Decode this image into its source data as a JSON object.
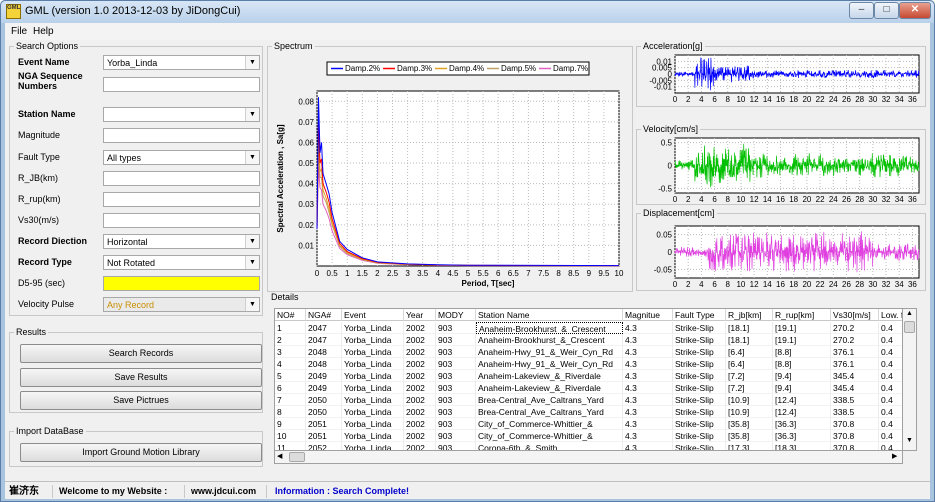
{
  "window": {
    "title": "GML (version 1.0 2013-12-03 by JiDongCui)",
    "icon": "GML"
  },
  "menu": [
    "File",
    "Help"
  ],
  "search": {
    "title": "Search Options",
    "fields": [
      {
        "label": "Event Name",
        "bold": true,
        "value": "Yorba_Linda",
        "dropdown": true,
        "style": ""
      },
      {
        "label": "NGA Sequence Numbers",
        "bold": true,
        "value": "",
        "dropdown": false,
        "style": ""
      },
      {
        "label": "Station Name",
        "bold": true,
        "value": "",
        "dropdown": true,
        "style": ""
      },
      {
        "label": "Magnitude",
        "bold": false,
        "value": "",
        "dropdown": false,
        "style": ""
      },
      {
        "label": "Fault Type",
        "bold": false,
        "value": "All types",
        "dropdown": true,
        "style": ""
      },
      {
        "label": "R_JB(km)",
        "bold": false,
        "value": "",
        "dropdown": false,
        "style": ""
      },
      {
        "label": "R_rup(km)",
        "bold": false,
        "value": "",
        "dropdown": false,
        "style": ""
      },
      {
        "label": "Vs30(m/s)",
        "bold": false,
        "value": "",
        "dropdown": false,
        "style": ""
      },
      {
        "label": "Record Diection",
        "bold": true,
        "value": "Horizontal",
        "dropdown": true,
        "style": ""
      },
      {
        "label": "Record Type",
        "bold": true,
        "value": "Not Rotated",
        "dropdown": true,
        "style": ""
      },
      {
        "label": "D5-95 (sec)",
        "bold": false,
        "value": "",
        "dropdown": false,
        "style": "yel"
      },
      {
        "label": "Velocity Pulse",
        "bold": false,
        "value": "Any Record",
        "dropdown": true,
        "style": "dis"
      }
    ]
  },
  "results": {
    "title": "Results",
    "buttons": [
      "Search Records",
      "Save Results",
      "Save Pictrues"
    ]
  },
  "import": {
    "title": "Import DataBase",
    "button": "Import Ground Motion Library"
  },
  "spectrum": {
    "title": "Spectrum",
    "legend": [
      "Damp.2%",
      "Damp.3%",
      "Damp.4%",
      "Damp.5%",
      "Damp.7%"
    ],
    "legend_colors": [
      "#0000ff",
      "#ff0000",
      "#e0a020",
      "#c0a060",
      "#e060c0"
    ],
    "ylabel": "Spectral Acceleration , Sa[g]",
    "xlabel": "Period, T[sec]"
  },
  "chart_data": [
    {
      "type": "line",
      "title": "Spectrum",
      "xlabel": "Period, T[sec]",
      "ylabel": "Spectral Acceleration , Sa[g]",
      "xlim": [
        0,
        10
      ],
      "ylim": [
        0,
        0.085
      ],
      "grid": true,
      "legend": "top",
      "xticks": [
        "0",
        "0.5",
        "1",
        "1.5",
        "2",
        "2.5",
        "3",
        "3.5",
        "4",
        "4.5",
        "5",
        "5.5",
        "6",
        "6.5",
        "7",
        "7.5",
        "8",
        "8.5",
        "9",
        "9.5",
        "10"
      ],
      "yticks": [
        "0.01",
        "0.02",
        "0.03",
        "0.04",
        "0.05",
        "0.06",
        "0.07",
        "0.08"
      ],
      "x": [
        0,
        0.05,
        0.1,
        0.15,
        0.2,
        0.3,
        0.4,
        0.5,
        0.75,
        1,
        1.5,
        2,
        3,
        4,
        5,
        10
      ],
      "series": [
        {
          "name": "Damp.2%",
          "values": [
            0.018,
            0.082,
            0.055,
            0.06,
            0.045,
            0.04,
            0.035,
            0.026,
            0.012,
            0.008,
            0.004,
            0.002,
            0.001,
            0.0006,
            0.0004,
            0.0002
          ]
        },
        {
          "name": "Damp.3%",
          "values": [
            0.018,
            0.07,
            0.05,
            0.052,
            0.04,
            0.036,
            0.031,
            0.023,
            0.011,
            0.007,
            0.0036,
            0.0018,
            0.0009,
            0.0005,
            0.0003,
            0.0002
          ]
        },
        {
          "name": "Damp.4%",
          "values": [
            0.018,
            0.062,
            0.046,
            0.047,
            0.037,
            0.033,
            0.028,
            0.021,
            0.01,
            0.0065,
            0.0033,
            0.0016,
            0.0008,
            0.0005,
            0.0003,
            0.0002
          ]
        },
        {
          "name": "Damp.5%",
          "values": [
            0.018,
            0.056,
            0.043,
            0.043,
            0.034,
            0.031,
            0.026,
            0.02,
            0.0095,
            0.006,
            0.003,
            0.0015,
            0.0007,
            0.0004,
            0.0003,
            0.0002
          ]
        },
        {
          "name": "Damp.7%",
          "values": [
            0.018,
            0.048,
            0.038,
            0.037,
            0.03,
            0.027,
            0.023,
            0.017,
            0.0085,
            0.0055,
            0.0027,
            0.0013,
            0.0006,
            0.0004,
            0.0002,
            0.0001
          ]
        }
      ]
    },
    {
      "type": "line",
      "title": "Acceleration[g]",
      "xlim": [
        0,
        37
      ],
      "ylim": [
        -0.015,
        0.015
      ],
      "yticks": [
        "0.01",
        "0.005",
        "0",
        "-0.005",
        "-0.01"
      ],
      "xticks": [
        "0",
        "2",
        "4",
        "6",
        "8",
        "10",
        "12",
        "14",
        "16",
        "18",
        "20",
        "22",
        "24",
        "26",
        "28",
        "30",
        "32",
        "34",
        "36"
      ],
      "color": "#0000ff"
    },
    {
      "type": "line",
      "title": "Velocity[cm/s]",
      "xlim": [
        0,
        37
      ],
      "ylim": [
        -0.6,
        0.6
      ],
      "yticks": [
        "0.5",
        "0",
        "-0.5"
      ],
      "xticks": [
        "0",
        "2",
        "4",
        "6",
        "8",
        "10",
        "12",
        "14",
        "16",
        "18",
        "20",
        "22",
        "24",
        "26",
        "28",
        "30",
        "32",
        "34",
        "36"
      ],
      "color": "#00c000"
    },
    {
      "type": "line",
      "title": "Displacement[cm]",
      "xlim": [
        0,
        37
      ],
      "ylim": [
        -0.075,
        0.075
      ],
      "yticks": [
        "0.05",
        "0",
        "-0.05"
      ],
      "xticks": [
        "0",
        "2",
        "4",
        "6",
        "8",
        "10",
        "12",
        "14",
        "16",
        "18",
        "20",
        "22",
        "24",
        "26",
        "28",
        "30",
        "32",
        "34",
        "36"
      ],
      "color": "#e040e0"
    }
  ],
  "details": {
    "title": "Details",
    "columns": [
      "NO#",
      "NGA#",
      "Event",
      "Year",
      "MODY",
      "Station Name",
      "Magnitue",
      "Fault Type",
      "R_jb[km]",
      "R_rup[km]",
      "Vs30[m/s]",
      "Low. fre"
    ],
    "rows": [
      [
        "1",
        "2047",
        "Yorba_Linda",
        "2002",
        "903",
        "Anaheim-Brookhurst_&_Crescent",
        "4.3",
        "Strike-Slip",
        "[18.1]",
        "[19.1]",
        "270.2",
        "0.4"
      ],
      [
        "2",
        "2047",
        "Yorba_Linda",
        "2002",
        "903",
        "Anaheim-Brookhurst_&_Crescent",
        "4.3",
        "Strike-Slip",
        "[18.1]",
        "[19.1]",
        "270.2",
        "0.4"
      ],
      [
        "3",
        "2048",
        "Yorba_Linda",
        "2002",
        "903",
        "Anaheim-Hwy_91_&_Weir_Cyn_Rd",
        "4.3",
        "Strike-Slip",
        "[6.4]",
        "[8.8]",
        "376.1",
        "0.4"
      ],
      [
        "4",
        "2048",
        "Yorba_Linda",
        "2002",
        "903",
        "Anaheim-Hwy_91_&_Weir_Cyn_Rd",
        "4.3",
        "Strike-Slip",
        "[6.4]",
        "[8.8]",
        "376.1",
        "0.4"
      ],
      [
        "5",
        "2049",
        "Yorba_Linda",
        "2002",
        "903",
        "Anaheim-Lakeview_&_Riverdale",
        "4.3",
        "Strike-Slip",
        "[7.2]",
        "[9.4]",
        "345.4",
        "0.4"
      ],
      [
        "6",
        "2049",
        "Yorba_Linda",
        "2002",
        "903",
        "Anaheim-Lakeview_&_Riverdale",
        "4.3",
        "Strike-Slip",
        "[7.2]",
        "[9.4]",
        "345.4",
        "0.4"
      ],
      [
        "7",
        "2050",
        "Yorba_Linda",
        "2002",
        "903",
        "Brea-Central_Ave_Caltrans_Yard",
        "4.3",
        "Strike-Slip",
        "[10.9]",
        "[12.4]",
        "338.5",
        "0.4"
      ],
      [
        "8",
        "2050",
        "Yorba_Linda",
        "2002",
        "903",
        "Brea-Central_Ave_Caltrans_Yard",
        "4.3",
        "Strike-Slip",
        "[10.9]",
        "[12.4]",
        "338.5",
        "0.4"
      ],
      [
        "9",
        "2051",
        "Yorba_Linda",
        "2002",
        "903",
        "City_of_Commerce-Whittier_&",
        "4.3",
        "Strike-Slip",
        "[35.8]",
        "[36.3]",
        "370.8",
        "0.4"
      ],
      [
        "10",
        "2051",
        "Yorba_Linda",
        "2002",
        "903",
        "City_of_Commerce-Whittier_&",
        "4.3",
        "Strike-Slip",
        "[35.8]",
        "[36.3]",
        "370.8",
        "0.4"
      ],
      [
        "11",
        "2052",
        "Yorba_Linda",
        "2002",
        "903",
        "Corona-6th_&_Smith",
        "4.3",
        "Strike-Slip",
        "[17.3]",
        "[18.3]",
        "370.8",
        "0.4"
      ]
    ]
  },
  "status": {
    "name": "崔济东",
    "welcome": "Welcome to my Website :",
    "url": "www.jdcui.com",
    "info": "Information : Search Complete!",
    "info_color": "#0000cc"
  }
}
